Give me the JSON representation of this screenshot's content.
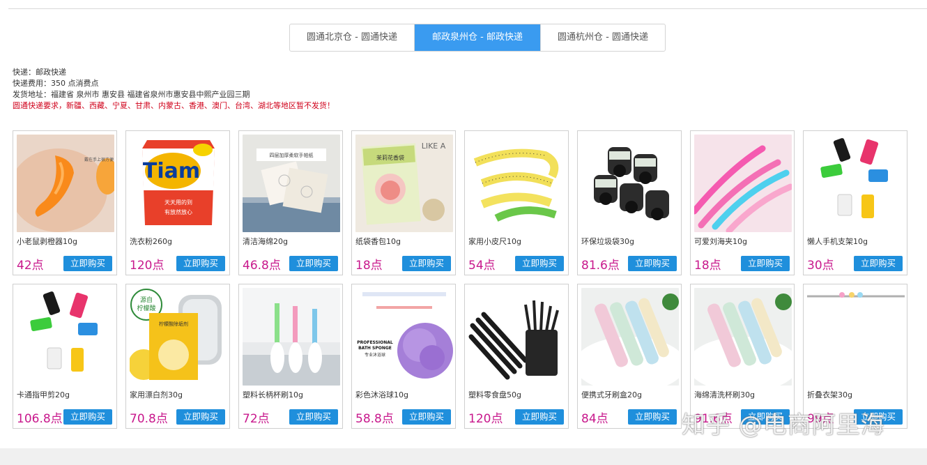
{
  "tabs": [
    {
      "label": "圆通北京仓 - 圆通快递",
      "active": false
    },
    {
      "label": "邮政泉州仓 - 邮政快递",
      "active": true
    },
    {
      "label": "圆通杭州仓 - 圆通快递",
      "active": false
    }
  ],
  "info": {
    "express": "快递：邮政快递",
    "fee": "快递费用：350 点消费点",
    "address": "发货地址：福建省 泉州市 惠安县 福建省泉州市惠安县中熙产业园三期",
    "warning": "圆通快递要求，新疆、西藏、宁夏、甘肃、内蒙古、香港、澳门、台湾、湖北等地区暂不发货！"
  },
  "buy_label": "立即购买",
  "products": [
    {
      "name": "小老鼠剥橙器10g",
      "price": "42点",
      "icon": "orange-peeler-icon",
      "image_text": "戴在手上很方便"
    },
    {
      "name": "洗衣粉260g",
      "price": "120点",
      "icon": "detergent-icon",
      "image_text": "Tiam",
      "image_text2": "天天用的到",
      "image_text3": "有放然放心"
    },
    {
      "name": "清洁海绵20g",
      "price": "46.8点",
      "icon": "sponge-icon",
      "image_text": "四层加厚柔软手帕纸"
    },
    {
      "name": "纸袋香包10g",
      "price": "18点",
      "icon": "sachet-icon",
      "image_text": "茉莉花香袋",
      "image_text2": "LIKE A"
    },
    {
      "name": "家用小皮尺10g",
      "price": "54点",
      "icon": "tape-measure-icon"
    },
    {
      "name": "环保垃圾袋30g",
      "price": "81.6点",
      "icon": "garbage-bag-icon"
    },
    {
      "name": "可爱刘海夹10g",
      "price": "18点",
      "icon": "hair-clip-icon"
    },
    {
      "name": "懒人手机支架10g",
      "price": "30点",
      "icon": "phone-stand-icon"
    },
    {
      "name": "卡通指甲剪20g",
      "price": "106.8点",
      "icon": "nail-clipper-icon"
    },
    {
      "name": "家用漂白剂30g",
      "price": "70.8点",
      "icon": "bleach-icon",
      "image_text": "源自",
      "image_text2": "柠檬酸",
      "image_text3": "柠檬酸除垢剂"
    },
    {
      "name": "塑料长柄杯刷10g",
      "price": "72点",
      "icon": "cup-brush-icon"
    },
    {
      "name": "彩色沐浴球10g",
      "price": "58.8点",
      "icon": "bath-ball-icon",
      "image_text": "PROFESSIONAL",
      "image_text2": "BATH SPONGE",
      "image_text3": "专业沐浴球"
    },
    {
      "name": "塑料零食盘50g",
      "price": "120点",
      "icon": "pens-icon"
    },
    {
      "name": "便携式牙刷盒20g",
      "price": "84点",
      "icon": "toothbrush-box-icon"
    },
    {
      "name": "海绵清洗杯刷30g",
      "price": "91.6点",
      "icon": "sponge-brush-icon"
    },
    {
      "name": "折叠衣架30g",
      "price": "99点",
      "icon": "hanger-icon"
    }
  ],
  "watermark": "知乎 @电商阿里海",
  "colors": {
    "accent": "#3a9bf0",
    "button": "#1f8fdc",
    "price": "#c8188c",
    "warning": "#d0021b"
  }
}
